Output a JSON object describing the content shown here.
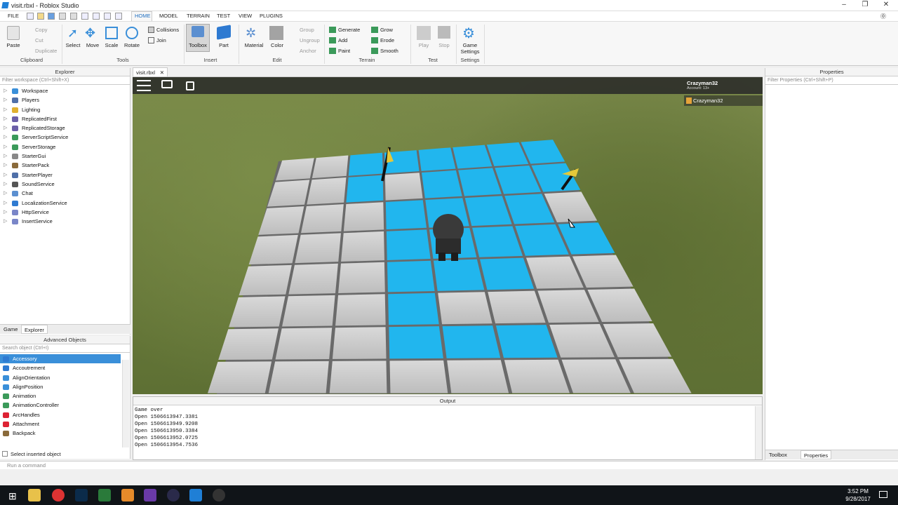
{
  "window": {
    "title": "visit.rbxl - Roblox Studio",
    "controls": [
      "–",
      "❐",
      "✕"
    ]
  },
  "menu": {
    "file": "FILE",
    "tabs": [
      "HOME",
      "MODEL",
      "TERRAIN",
      "TEST",
      "VIEW",
      "PLUGINS"
    ],
    "active_tab": "HOME"
  },
  "ribbon": {
    "clipboard": {
      "paste": "Paste",
      "copy": "Copy",
      "cut": "Cut",
      "duplicate": "Duplicate",
      "label": "Clipboard"
    },
    "tools": {
      "select": "Select",
      "move": "Move",
      "scale": "Scale",
      "rotate": "Rotate",
      "collisions": "Collisions",
      "join": "Join",
      "label": "Tools"
    },
    "insert": {
      "toolbox": "Toolbox",
      "part": "Part",
      "label": "Insert"
    },
    "edit": {
      "material": "Material",
      "color": "Color",
      "group": "Group",
      "ungroup": "Ungroup",
      "anchor": "Anchor",
      "label": "Edit"
    },
    "terrain": {
      "generate": "Generate",
      "add": "Add",
      "paint": "Paint",
      "grow": "Grow",
      "erode": "Erode",
      "smooth": "Smooth",
      "label": "Terrain"
    },
    "test": {
      "play": "Play",
      "stop": "Stop",
      "label": "Test"
    },
    "settings": {
      "game_settings_1": "Game",
      "game_settings_2": "Settings",
      "label": "Settings"
    }
  },
  "explorer": {
    "title": "Explorer",
    "filter_placeholder": "Filter workspace (Ctrl+Shift+X)",
    "items": [
      {
        "label": "Workspace",
        "color": "#3a8fd9"
      },
      {
        "label": "Players",
        "color": "#4f6fa8"
      },
      {
        "label": "Lighting",
        "color": "#e0b030"
      },
      {
        "label": "ReplicatedFirst",
        "color": "#6c5fa8"
      },
      {
        "label": "ReplicatedStorage",
        "color": "#6c5fa8"
      },
      {
        "label": "ServerScriptService",
        "color": "#3b9a5a"
      },
      {
        "label": "ServerStorage",
        "color": "#3b9a5a"
      },
      {
        "label": "StarterGui",
        "color": "#888"
      },
      {
        "label": "StarterPack",
        "color": "#8a6a3a"
      },
      {
        "label": "StarterPlayer",
        "color": "#4f6fa8"
      },
      {
        "label": "SoundService",
        "color": "#555"
      },
      {
        "label": "Chat",
        "color": "#5b8fd0"
      },
      {
        "label": "LocalizationService",
        "color": "#2e7ad1"
      },
      {
        "label": "HttpService",
        "color": "#7a86c8"
      },
      {
        "label": "InsertService",
        "color": "#7a86c8"
      }
    ],
    "bottom_tabs": [
      "Game",
      "Explorer"
    ]
  },
  "advanced_objects": {
    "title": "Advanced Objects",
    "search_placeholder": "Search object (Ctrl+I)",
    "items": [
      {
        "label": "Accessory",
        "color": "#2e7ad1"
      },
      {
        "label": "Accoutrement",
        "color": "#2e7ad1"
      },
      {
        "label": "AlignOrientation",
        "color": "#3a8fd9"
      },
      {
        "label": "AlignPosition",
        "color": "#3a8fd9"
      },
      {
        "label": "Animation",
        "color": "#3b9a5a"
      },
      {
        "label": "AnimationController",
        "color": "#3b9a5a"
      },
      {
        "label": "ArcHandles",
        "color": "#d23"
      },
      {
        "label": "Attachment",
        "color": "#d23"
      },
      {
        "label": "Backpack",
        "color": "#8a6a3a"
      }
    ],
    "checkbox_label": "Select inserted object"
  },
  "document": {
    "tab": "visit.rbxl"
  },
  "game": {
    "player_name": "Crazyman32",
    "account": "Account: 13+",
    "leaderboard_name": "Crazyman32"
  },
  "properties": {
    "title": "Properties",
    "filter_placeholder": "Filter Properties (Ctrl+Shift+P)",
    "bottom_tabs": [
      "Toolbox",
      "Properties"
    ]
  },
  "output": {
    "title": "Output",
    "lines": [
      "Game over",
      "Open 1506613947.3381",
      "Open 1506613949.9208",
      "Open 1506613950.3384",
      "Open 1506613952.0725",
      "Open 1506613954.7536"
    ]
  },
  "command": {
    "placeholder": "Run a command"
  },
  "taskbar": {
    "time": "3:52 PM",
    "date": "9/28/2017"
  }
}
